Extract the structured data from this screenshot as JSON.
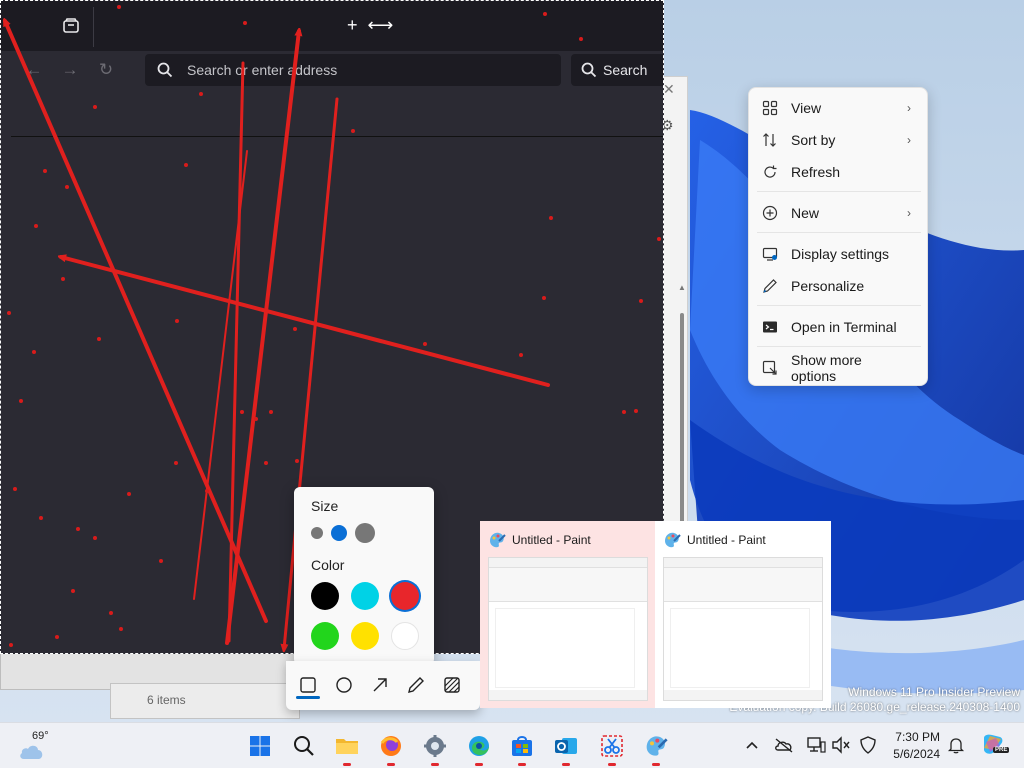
{
  "browser": {
    "url_placeholder": "Search or enter address",
    "search_label": "Search",
    "icons": [
      "tab-manager-icon",
      "move-cursor-icon",
      "back-icon",
      "forward-icon",
      "reload-icon",
      "search-icon"
    ]
  },
  "context_menu": {
    "items": [
      {
        "label": "View",
        "icon": "grid-icon",
        "submenu": true
      },
      {
        "label": "Sort by",
        "icon": "sort-icon",
        "submenu": true
      },
      {
        "label": "Refresh",
        "icon": "refresh-icon",
        "submenu": false
      },
      {
        "label": "New",
        "icon": "plus-circle-icon",
        "submenu": true
      },
      {
        "label": "Display settings",
        "icon": "display-icon",
        "submenu": false
      },
      {
        "label": "Personalize",
        "icon": "pen-icon",
        "submenu": false
      },
      {
        "label": "Open in Terminal",
        "icon": "terminal-icon",
        "submenu": false
      },
      {
        "label": "Show more options",
        "icon": "more-options-icon",
        "submenu": false
      }
    ]
  },
  "pen_popup": {
    "size_heading": "Size",
    "color_heading": "Color",
    "sizes": [
      "small",
      "medium",
      "large"
    ],
    "selected_size": "medium",
    "colors": [
      "#000000",
      "#00d2e6",
      "#e8262b",
      "#22d51c",
      "#ffe100",
      "#ffffff"
    ],
    "selected_color": "#e8262b"
  },
  "shape_toolbar": {
    "tools": [
      "rectangle-icon",
      "ellipse-icon",
      "arrow-icon",
      "pen-icon",
      "hatch-icon"
    ],
    "selected_tool": "rectangle-icon"
  },
  "thumbnails": [
    {
      "title": "Untitled - Paint",
      "highlighted": true
    },
    {
      "title": "Untitled - Paint",
      "highlighted": false
    }
  ],
  "other_window": {
    "status_text": "6 items"
  },
  "watermark": {
    "line1": "Windows 11 Pro Insider Preview",
    "line2": "Evaluation copy. Build 26080.ge_release.240308-1400"
  },
  "taskbar": {
    "weather_temp": "69°",
    "apps": [
      "start-icon",
      "search-icon",
      "file-explorer-icon",
      "firefox-icon",
      "settings-icon",
      "edge-icon",
      "microsoft-store-icon",
      "outlook-icon",
      "snipping-tool-icon",
      "paint-icon"
    ],
    "tray": [
      "chevron-up-icon",
      "onedrive-off-icon",
      "network-icon",
      "volume-muted-icon",
      "security-icon"
    ],
    "time": "7:30 PM",
    "date": "5/6/2024",
    "copilot_badge": "PRE"
  }
}
